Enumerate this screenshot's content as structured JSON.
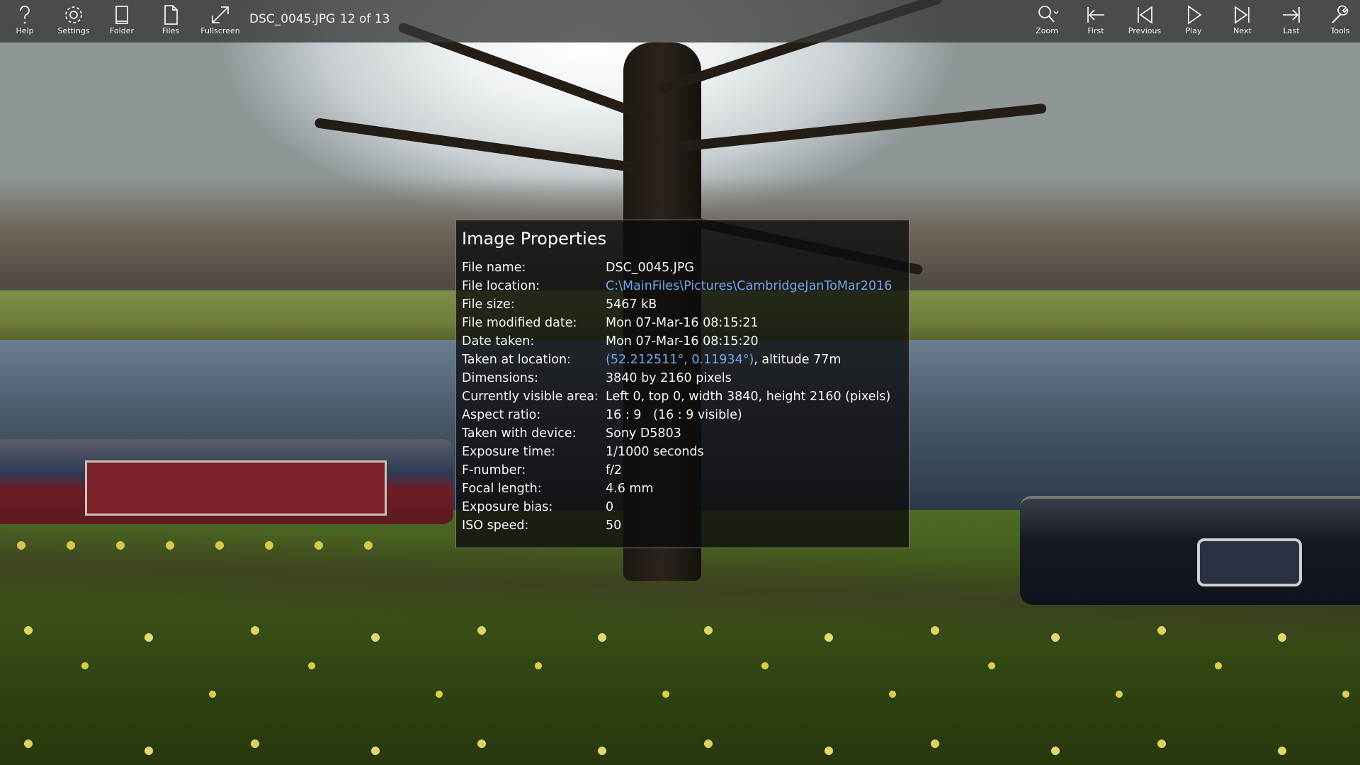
{
  "toolbar": {
    "left_buttons": [
      {
        "label": "Help",
        "icon": "help-icon"
      },
      {
        "label": "Settings",
        "icon": "gear-icon"
      },
      {
        "label": "Folder",
        "icon": "folder-icon"
      },
      {
        "label": "Files",
        "icon": "files-icon"
      },
      {
        "label": "Fullscreen",
        "icon": "fullscreen-icon"
      }
    ],
    "file_name": "DSC_0045.JPG",
    "counter": "12 of 13",
    "right_buttons": [
      {
        "label": "Zoom",
        "icon": "zoom-icon"
      },
      {
        "label": "First",
        "icon": "first-icon"
      },
      {
        "label": "Previous",
        "icon": "previous-icon"
      },
      {
        "label": "Play",
        "icon": "play-icon"
      },
      {
        "label": "Next",
        "icon": "next-icon"
      },
      {
        "label": "Last",
        "icon": "last-icon"
      },
      {
        "label": "Tools",
        "icon": "tools-icon"
      }
    ]
  },
  "properties": {
    "title": "Image Properties",
    "rows": [
      {
        "label": "File name:",
        "value": "DSC_0045.JPG"
      },
      {
        "label": "File location:",
        "link": "C:\\MainFiles\\Pictures\\CambridgeJanToMar2016"
      },
      {
        "label": "File size:",
        "value": "5467 kB"
      },
      {
        "label": "File modified date:",
        "value": "Mon 07-Mar-16 08:15:21"
      },
      {
        "label": "Date taken:",
        "value": "Mon 07-Mar-16 08:15:20"
      },
      {
        "label": "Taken at location:",
        "link": "(52.212511°, 0.11934°)",
        "value": ", altitude 77m"
      },
      {
        "label": "Dimensions:",
        "value": "3840 by 2160 pixels"
      },
      {
        "label": "Currently visible area:",
        "value": "Left 0, top 0, width 3840, height 2160 (pixels)"
      },
      {
        "label": "Aspect ratio:",
        "value": "16 : 9   (16 : 9 visible)"
      },
      {
        "label": "Taken with device:",
        "value": "Sony D5803"
      },
      {
        "label": "Exposure time:",
        "value": "1/1000 seconds"
      },
      {
        "label": "F-number:",
        "value": "f/2"
      },
      {
        "label": "Focal length:",
        "value": "4.6 mm"
      },
      {
        "label": "Exposure bias:",
        "value": "0"
      },
      {
        "label": "ISO speed:",
        "value": "50"
      }
    ]
  },
  "colors": {
    "link": "#6fa8ec",
    "toolbar_bg": "#373737",
    "panel_bg": "#0c0c0c"
  }
}
